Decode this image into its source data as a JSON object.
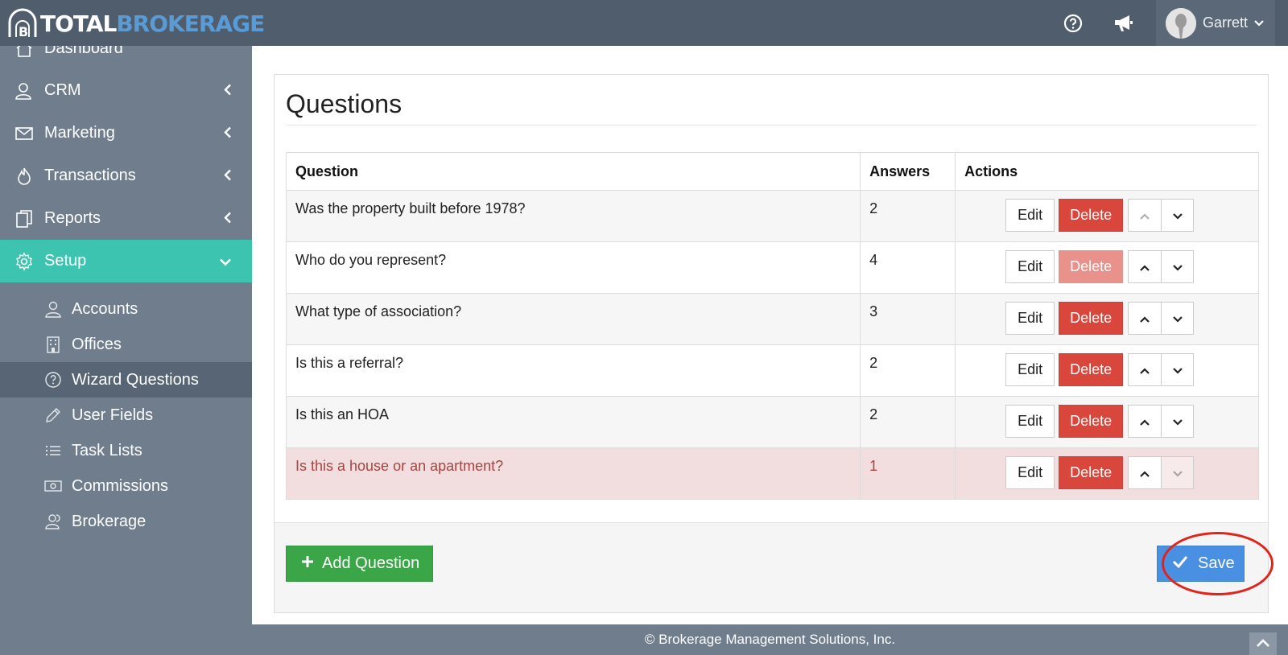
{
  "header": {
    "logo_word1": "TOTAL",
    "logo_word2": "BROKERAGE",
    "help_icon": "question-circle-icon",
    "announce_icon": "megaphone-icon",
    "user_name": "Garrett"
  },
  "sidebar": {
    "items": [
      {
        "label": "Dashboard",
        "icon": "home-icon"
      },
      {
        "label": "CRM",
        "icon": "contacts-icon"
      },
      {
        "label": "Marketing",
        "icon": "envelope-icon"
      },
      {
        "label": "Transactions",
        "icon": "flame-icon"
      },
      {
        "label": "Reports",
        "icon": "documents-icon"
      },
      {
        "label": "Setup",
        "icon": "gear-icon",
        "active": true
      }
    ],
    "subitems": [
      {
        "label": "Accounts",
        "icon": "user-icon"
      },
      {
        "label": "Offices",
        "icon": "building-icon"
      },
      {
        "label": "Wizard Questions",
        "icon": "question-circle-icon",
        "current": true
      },
      {
        "label": "User Fields",
        "icon": "pencil-icon"
      },
      {
        "label": "Task Lists",
        "icon": "list-icon"
      },
      {
        "label": "Commissions",
        "icon": "money-icon"
      },
      {
        "label": "Brokerage",
        "icon": "users-icon"
      }
    ]
  },
  "main": {
    "title": "Questions",
    "columns": [
      "Question",
      "Answers",
      "Actions"
    ],
    "edit_label": "Edit",
    "delete_label": "Delete",
    "rows": [
      {
        "question": "Was the property built before 1978?",
        "answers": "2"
      },
      {
        "question": "Who do you represent?",
        "answers": "4"
      },
      {
        "question": "What type of association?",
        "answers": "3"
      },
      {
        "question": "Is this a referral?",
        "answers": "2"
      },
      {
        "question": "Is this an HOA",
        "answers": "2"
      },
      {
        "question": "Is this a house or an apartment?",
        "answers": "1"
      }
    ],
    "add_button": "Add Question",
    "save_button": "Save"
  },
  "footer": {
    "copyright": "© Brokerage Management Solutions, Inc."
  },
  "colors": {
    "topbar": "#4f5d6d",
    "sidebar": "#6f7d8c",
    "active": "#3cc4b0",
    "danger": "#d9463b",
    "success": "#3aa648",
    "primary": "#4a90e2",
    "highlight": "#e2231a"
  }
}
